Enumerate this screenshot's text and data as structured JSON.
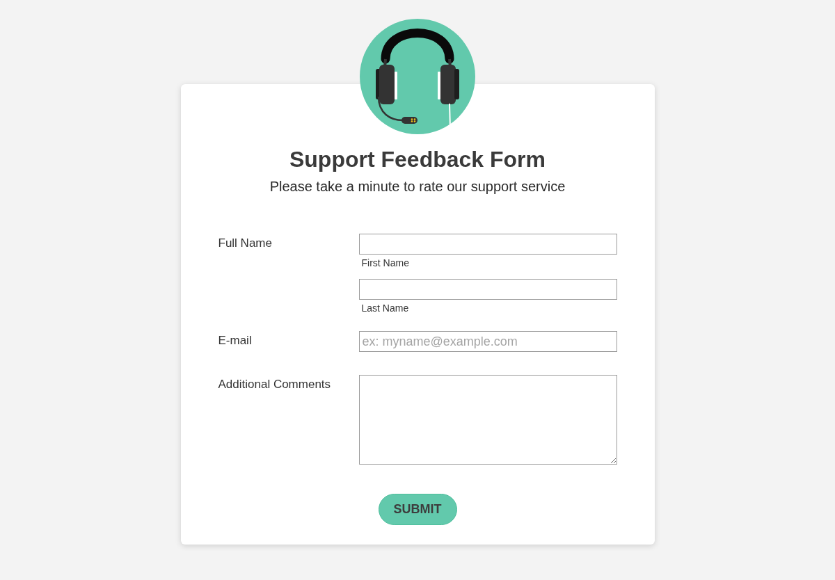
{
  "header": {
    "title": "Support Feedback Form",
    "subtitle": "Please take a minute to rate our support service"
  },
  "fields": [
    {
      "kind": "name",
      "label": "Full Name",
      "parts": [
        {
          "caption": "First Name"
        },
        {
          "caption": "Last Name"
        }
      ]
    },
    {
      "kind": "email",
      "label": "E-mail",
      "placeholder": "ex: myname@example.com"
    },
    {
      "kind": "textarea",
      "label": "Additional Comments"
    }
  ],
  "submit": {
    "label": "SUBMIT"
  }
}
